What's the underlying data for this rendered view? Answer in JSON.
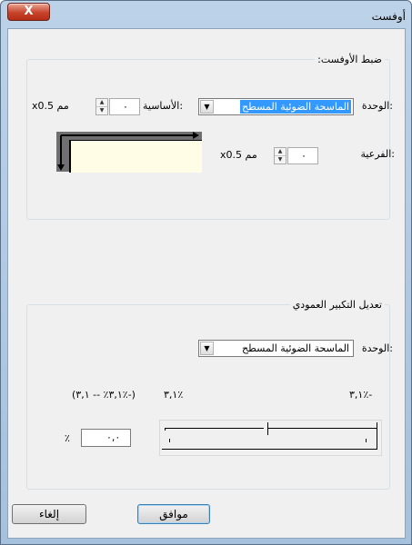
{
  "window": {
    "title": "أوفست",
    "close_label": "X"
  },
  "offset_group": {
    "legend": "ضبط الأوفست:",
    "unit_label": "الوحدة:",
    "unit_value": "الماسحة الضوئية المسطح",
    "primary_label": "الأساسية:",
    "primary_value": "٠",
    "primary_step": "x0.5 مم",
    "secondary_label": "الفرعية:",
    "secondary_value": "٠",
    "secondary_step": "x0.5 مم"
  },
  "vertical_group": {
    "legend": "تعديل التكبير العمودي",
    "unit_label": "الوحدة:",
    "unit_value": "الماسحة الضوئية المسطح",
    "range_text": "(٣,١٪ -- ٣,١٪-)",
    "max_label": "٣,١٪",
    "min_label": "٣,١٪-",
    "percent_value": "٠,٠",
    "percent_sign": "٪",
    "slider_position": 0.5
  },
  "buttons": {
    "ok": "موافق",
    "cancel": "إلغاء"
  }
}
